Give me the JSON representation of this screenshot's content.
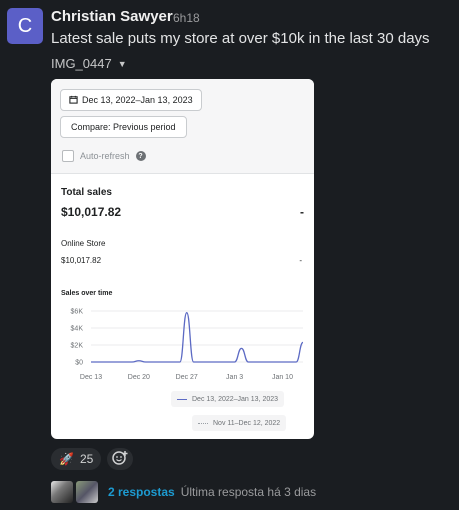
{
  "message": {
    "avatar_initial": "C",
    "author": "Christian Sawyer",
    "time": "6h18",
    "text": "Latest sale puts my store at over $10k in the last 30 days",
    "attachment_name": "IMG_0447"
  },
  "screenshot": {
    "date_range_button": "Dec 13, 2022–Jan 13, 2023",
    "compare_button": "Compare: Previous period",
    "auto_refresh_label": "Auto-refresh",
    "total_sales_label": "Total sales",
    "total_sales_value": "$10,017.82",
    "total_sales_change": "-",
    "online_store_label": "Online Store",
    "online_store_value": "$10,017.82",
    "online_store_change": "-",
    "chart_title": "Sales over time",
    "legend_current": "Dec 13, 2022–Jan 13, 2023",
    "legend_previous": "Nov 11–Dec 12, 2022"
  },
  "chart_data": {
    "type": "line",
    "title": "Sales over time",
    "xlabel": "",
    "ylabel": "",
    "ylim": [
      0,
      6000
    ],
    "yticks": [
      "$6K",
      "$4K",
      "$2K",
      "$0"
    ],
    "xticks": [
      "Dec 13",
      "Dec 20",
      "Dec 27",
      "Jan 3",
      "Jan 10"
    ],
    "x": [
      "Dec 13",
      "Dec 14",
      "Dec 15",
      "Dec 16",
      "Dec 17",
      "Dec 18",
      "Dec 19",
      "Dec 20",
      "Dec 21",
      "Dec 22",
      "Dec 23",
      "Dec 24",
      "Dec 25",
      "Dec 26",
      "Dec 27",
      "Dec 28",
      "Dec 29",
      "Dec 30",
      "Dec 31",
      "Jan 1",
      "Jan 2",
      "Jan 3",
      "Jan 4",
      "Jan 5",
      "Jan 6",
      "Jan 7",
      "Jan 8",
      "Jan 9",
      "Jan 10",
      "Jan 11",
      "Jan 12",
      "Jan 13"
    ],
    "series": [
      {
        "name": "Dec 13, 2022–Jan 13, 2023",
        "color": "#5c6ac4",
        "values": [
          0,
          0,
          0,
          0,
          0,
          0,
          0,
          150,
          0,
          0,
          0,
          0,
          0,
          0,
          5800,
          0,
          0,
          0,
          0,
          0,
          0,
          0,
          1600,
          0,
          0,
          0,
          0,
          0,
          0,
          0,
          0,
          2300
        ]
      }
    ],
    "legend": "bottom-right",
    "grid": true
  },
  "reactions": {
    "rocket_count": "25"
  },
  "thread": {
    "replies": "2 respostas",
    "last_reply": "Última resposta há 3 dias"
  },
  "colors": {
    "background": "#1a1d21",
    "avatar": "#5b5fc7",
    "link": "#1d9bd1",
    "series": "#5c6ac4"
  }
}
